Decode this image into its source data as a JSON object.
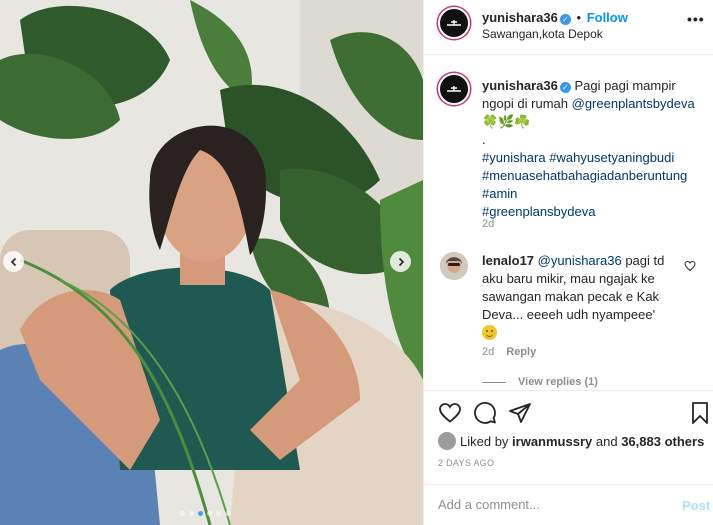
{
  "post": {
    "username": "yunishara36",
    "follow_label": "Follow",
    "location": "Sawangan,kota Depok",
    "more_label": "•••"
  },
  "caption": {
    "username": "yunishara36",
    "text": "Pagi pagi mampir ngopi di rumah",
    "mention": "@greenplantsbydeva",
    "emojis": "🍀🌿☘️",
    "separator": ".",
    "hashtags": [
      "#yunishara",
      "#wahyusetyaningbudi",
      "#menuasehatbahagiadanberuntung",
      "#amin",
      "#greenplansbydeva"
    ],
    "time": "2d"
  },
  "comment": {
    "username": "lenalo17",
    "mention": "@yunishara36",
    "text": "pagi td aku baru mikir, mau ngajak ke sawangan makan pecak e Kak Deva... eeeeh udh nyampeee'",
    "time": "2d",
    "reply_label": "Reply",
    "view_replies_label": "View replies (1)"
  },
  "likes": {
    "prefix": "Liked by",
    "user": "irwanmussry",
    "conjunction": "and",
    "count": "36,883 others"
  },
  "date": "2 DAYS AGO",
  "add_comment": {
    "placeholder": "Add a comment...",
    "post_label": "Post"
  },
  "carousel": {
    "total": 6,
    "active_index": 2
  },
  "colors": {
    "link": "#00376b",
    "accent": "#0095f6",
    "post_disabled": "#b2dffc",
    "verified": "#3897f0"
  }
}
